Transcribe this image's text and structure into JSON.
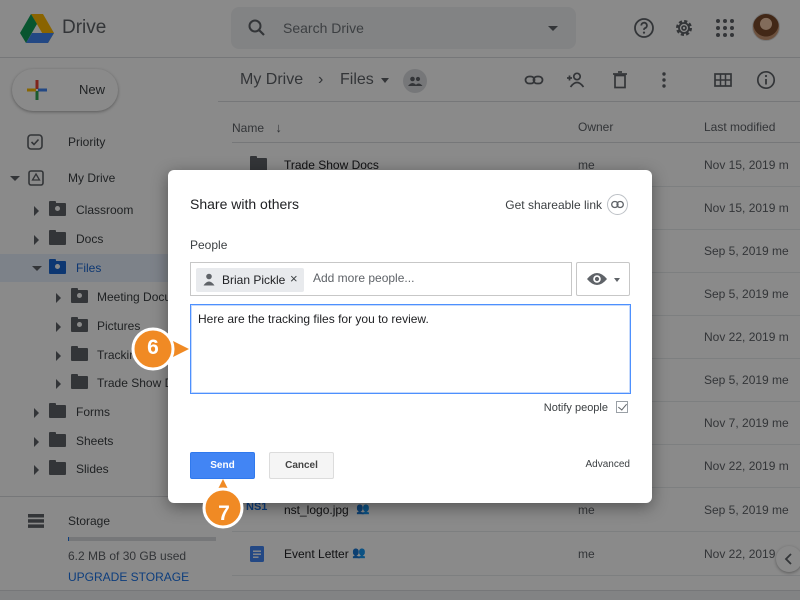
{
  "header": {
    "app_title": "Drive",
    "search_placeholder": "Search Drive"
  },
  "sidebar": {
    "new_label": "New",
    "items": [
      {
        "label": "Priority"
      },
      {
        "label": "My Drive"
      },
      {
        "label": "Classroom"
      },
      {
        "label": "Docs"
      },
      {
        "label": "Files"
      },
      {
        "label": "Meeting Docu"
      },
      {
        "label": "Pictures"
      },
      {
        "label": "Trackin"
      },
      {
        "label": "Trade Show D"
      },
      {
        "label": "Forms"
      },
      {
        "label": "Sheets"
      },
      {
        "label": "Slides"
      }
    ],
    "storage_label": "Storage",
    "storage_used": "6.2 MB of 30 GB used",
    "storage_fraction": 0.0002,
    "upgrade_label": "UPGRADE STORAGE"
  },
  "toolbar": {
    "crumb_root": "My Drive",
    "crumb_sep": "›",
    "crumb_current": "Files"
  },
  "columns": {
    "name": "Name",
    "owner": "Owner",
    "modified": "Last modified"
  },
  "files": [
    {
      "name": "Trade Show Docs",
      "owner": "me",
      "modified": "Nov 15, 2019 m"
    },
    {
      "name": "",
      "owner": "",
      "modified": "Nov 15, 2019 m"
    },
    {
      "name": "",
      "owner": "",
      "modified": "Sep 5, 2019 me"
    },
    {
      "name": "",
      "owner": "",
      "modified": "Sep 5, 2019 me"
    },
    {
      "name": "",
      "owner": "",
      "modified": "Nov 22, 2019 m"
    },
    {
      "name": "",
      "owner": "",
      "modified": "Sep 5, 2019 me"
    },
    {
      "name": "",
      "owner": "",
      "modified": "Nov 7, 2019 me"
    },
    {
      "name": "",
      "owner": "",
      "modified": "Nov 22, 2019 m"
    },
    {
      "name": "nst_logo.jpg",
      "owner": "me",
      "modified": "Sep 5, 2019 me"
    },
    {
      "name": "Event Letter",
      "owner": "me",
      "modified": "Nov 22, 2019 m"
    }
  ],
  "dialog": {
    "title": "Share with others",
    "shareable_link": "Get shareable link",
    "people_label": "People",
    "chip_name": "Brian Pickle",
    "chip_remove": "×",
    "add_people_placeholder": "Add more people...",
    "message": "Here are the tracking files for you to review.",
    "notify_label": "Notify people",
    "send_label": "Send",
    "cancel_label": "Cancel",
    "advanced_label": "Advanced"
  },
  "callouts": {
    "step6": "6",
    "step7": "7"
  },
  "colors": {
    "accent": "#1a73e8",
    "callout": "#f08a24",
    "send": "#4285f4"
  }
}
